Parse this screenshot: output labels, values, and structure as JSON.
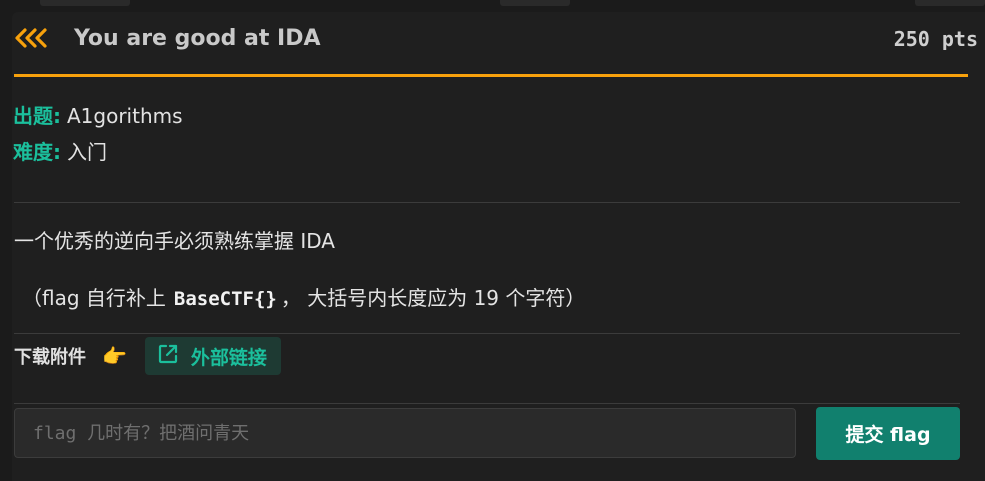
{
  "challenge": {
    "title": "You are good at IDA",
    "points": "250 pts"
  },
  "meta": {
    "author_key": "出题:",
    "author_value": "A1gorithms",
    "difficulty_key": "难度:",
    "difficulty_value": "入门"
  },
  "description": {
    "line1": "一个优秀的逆向手必须熟练掌握 IDA",
    "line2_prefix": "（flag 自行补上",
    "line2_code": "BaseCTF{}",
    "line2_suffix": "， 大括号内长度应为 19 个字符）"
  },
  "attachments": {
    "label": "下载附件",
    "hand_icon": "👉",
    "link_label": "外部链接"
  },
  "flag_form": {
    "placeholder": "flag 几时有？把酒问青天",
    "value": "",
    "submit_label": "提交 flag"
  },
  "colors": {
    "accent": "#f7a10c",
    "teal": "#1bbf9c",
    "submit_bg": "#11806e"
  },
  "icons": {
    "back": "triple-chevron-left-icon",
    "external_link": "external-link-icon",
    "hand": "pointing-hand-icon"
  }
}
